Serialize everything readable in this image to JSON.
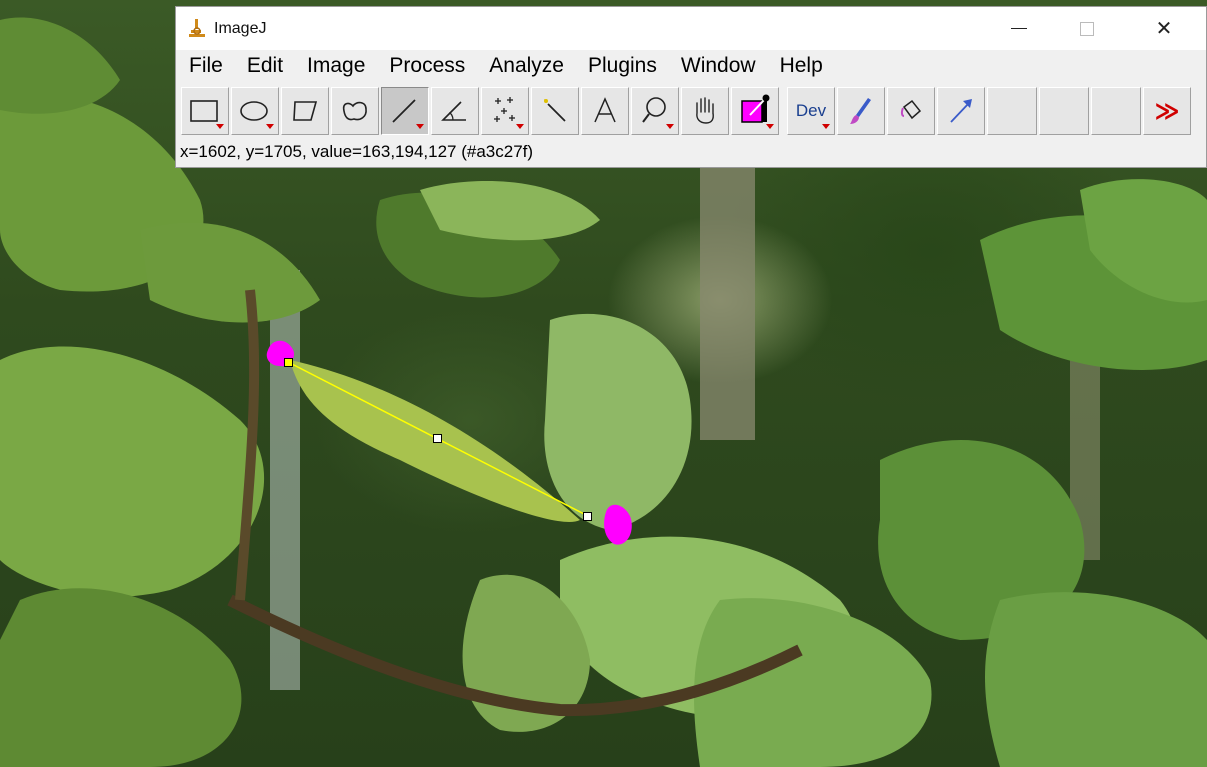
{
  "window": {
    "title": "ImageJ",
    "app_icon": "microscope-icon",
    "controls": {
      "minimize_icon": "minimize-icon",
      "maximize_icon": "maximize-icon",
      "close_label": "✕"
    }
  },
  "menu": {
    "items": [
      "File",
      "Edit",
      "Image",
      "Process",
      "Analyze",
      "Plugins",
      "Window",
      "Help"
    ]
  },
  "toolbar": {
    "tools": [
      {
        "name": "rectangle-tool",
        "icon": "rectangle-icon",
        "active": false,
        "has_menu": true
      },
      {
        "name": "oval-tool",
        "icon": "oval-icon",
        "active": false,
        "has_menu": true
      },
      {
        "name": "polygon-tool",
        "icon": "polygon-icon",
        "active": false,
        "has_menu": false
      },
      {
        "name": "freehand-tool",
        "icon": "freehand-icon",
        "active": false,
        "has_menu": false
      },
      {
        "name": "line-tool",
        "icon": "line-icon",
        "active": true,
        "has_menu": true
      },
      {
        "name": "angle-tool",
        "icon": "angle-icon",
        "active": false,
        "has_menu": false
      },
      {
        "name": "point-tool",
        "icon": "multipoint-icon",
        "active": false,
        "has_menu": true
      },
      {
        "name": "wand-tool",
        "icon": "wand-icon",
        "active": false,
        "has_menu": false
      },
      {
        "name": "text-tool",
        "icon": "text-icon",
        "active": false,
        "has_menu": false
      },
      {
        "name": "zoom-tool",
        "icon": "magnifier-icon",
        "active": false,
        "has_menu": true
      },
      {
        "name": "scroll-tool",
        "icon": "hand-icon",
        "active": false,
        "has_menu": false
      },
      {
        "name": "color-picker-tool",
        "icon": "color-picker-icon",
        "active": false,
        "has_menu": true
      }
    ],
    "dev_label": "Dev",
    "more_label": "≫"
  },
  "status": {
    "text": "x=1602, y=1705, value=163,194,127 (#a3c27f)"
  },
  "colors": {
    "selection_magenta": "#ff00ff",
    "line_selection": "#ffff00",
    "tool_active": "#c8c8c8",
    "dropdown_arrow": "#d00000"
  }
}
